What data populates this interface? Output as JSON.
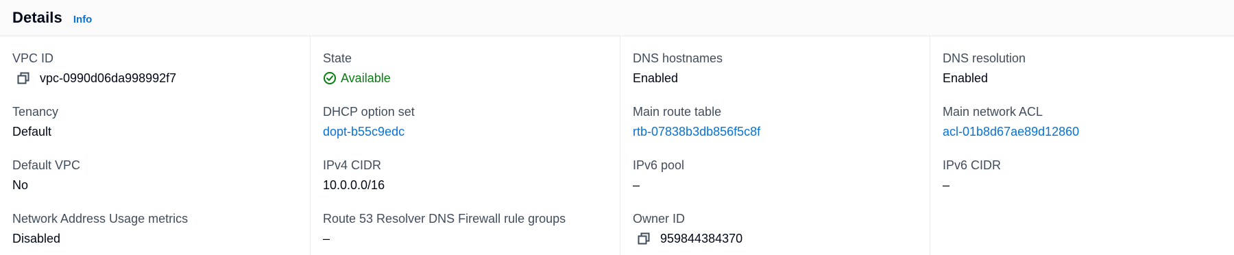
{
  "header": {
    "title": "Details",
    "info_link": "Info"
  },
  "columns": [
    [
      {
        "label": "VPC ID",
        "value": "vpc-0990d06da998992f7",
        "copyable": true
      },
      {
        "label": "Tenancy",
        "value": "Default"
      },
      {
        "label": "Default VPC",
        "value": "No"
      },
      {
        "label": "Network Address Usage metrics",
        "value": "Disabled"
      }
    ],
    [
      {
        "label": "State",
        "value": "Available",
        "status": "success",
        "status_color": "#037f0c"
      },
      {
        "label": "DHCP option set",
        "value": "dopt-b55c9edc",
        "link": true
      },
      {
        "label": "IPv4 CIDR",
        "value": "10.0.0.0/16"
      },
      {
        "label": "Route 53 Resolver DNS Firewall rule groups",
        "value": "–"
      }
    ],
    [
      {
        "label": "DNS hostnames",
        "value": "Enabled"
      },
      {
        "label": "Main route table",
        "value": "rtb-07838b3db856f5c8f",
        "link": true
      },
      {
        "label": "IPv6 pool",
        "value": "–"
      },
      {
        "label": "Owner ID",
        "value": "959844384370",
        "copyable": true
      }
    ],
    [
      {
        "label": "DNS resolution",
        "value": "Enabled"
      },
      {
        "label": "Main network ACL",
        "value": "acl-01b8d67ae89d12860",
        "link": true
      },
      {
        "label": "IPv6 CIDR",
        "value": "–"
      }
    ]
  ],
  "colors": {
    "link": "#0972d3",
    "success": "#037f0c",
    "label": "#414d5c",
    "text": "#000716"
  },
  "icons": {
    "copy": "copy-icon",
    "status": "status-positive-icon"
  }
}
